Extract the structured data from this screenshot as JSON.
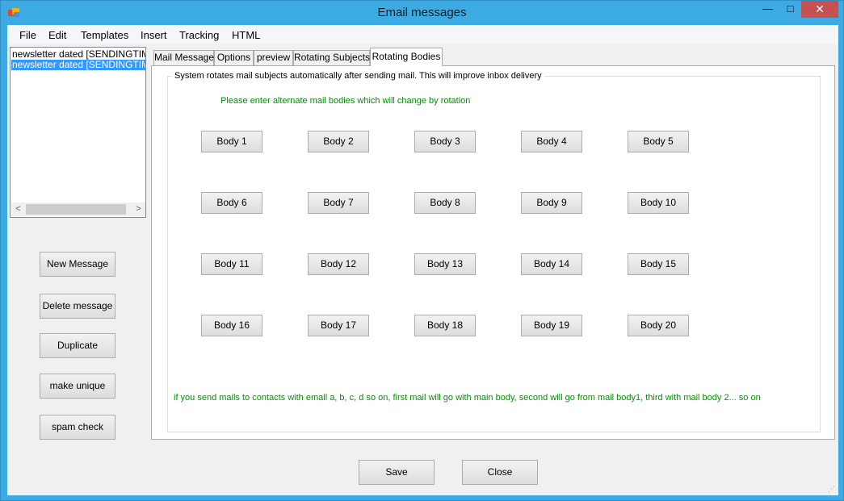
{
  "window": {
    "title": "Email messages",
    "controls": {
      "minimize": "—",
      "maximize": "□",
      "close": "✕"
    }
  },
  "menu": [
    "File",
    "Edit",
    "Templates",
    "Insert",
    "Tracking",
    "HTML"
  ],
  "messages": [
    {
      "label": "newsletter dated [SENDINGTIME]",
      "selected": false
    },
    {
      "label": "newsletter dated [SENDINGTIME]",
      "selected": true
    }
  ],
  "scroll": {
    "left": "<",
    "right": ">"
  },
  "side_buttons": {
    "new": "New Message",
    "delete": "Delete message",
    "duplicate": "Duplicate",
    "unique": "make unique",
    "spam": "spam check"
  },
  "tabs": [
    "Mail Message",
    "Options",
    "preview",
    "Rotating Subjects",
    "Rotating Bodies"
  ],
  "active_tab": "Rotating Bodies",
  "rotating_bodies": {
    "group_title": "System rotates mail subjects automatically after sending mail. This will improve inbox delivery",
    "instruction": "Please enter alternate mail bodies which will change by rotation",
    "bodies": [
      "Body 1",
      "Body 2",
      "Body 3",
      "Body 4",
      "Body 5",
      "Body 6",
      "Body 7",
      "Body 8",
      "Body 9",
      "Body 10",
      "Body 11",
      "Body 12",
      "Body 13",
      "Body 14",
      "Body 15",
      "Body 16",
      "Body 17",
      "Body 18",
      "Body 19",
      "Body 20"
    ],
    "note": "if you send mails to contacts with email  a, b, c, d  so on, first mail will go with main body, second will go from mail body1, third  with mail body 2... so on"
  },
  "footer": {
    "save": "Save",
    "close": "Close"
  }
}
